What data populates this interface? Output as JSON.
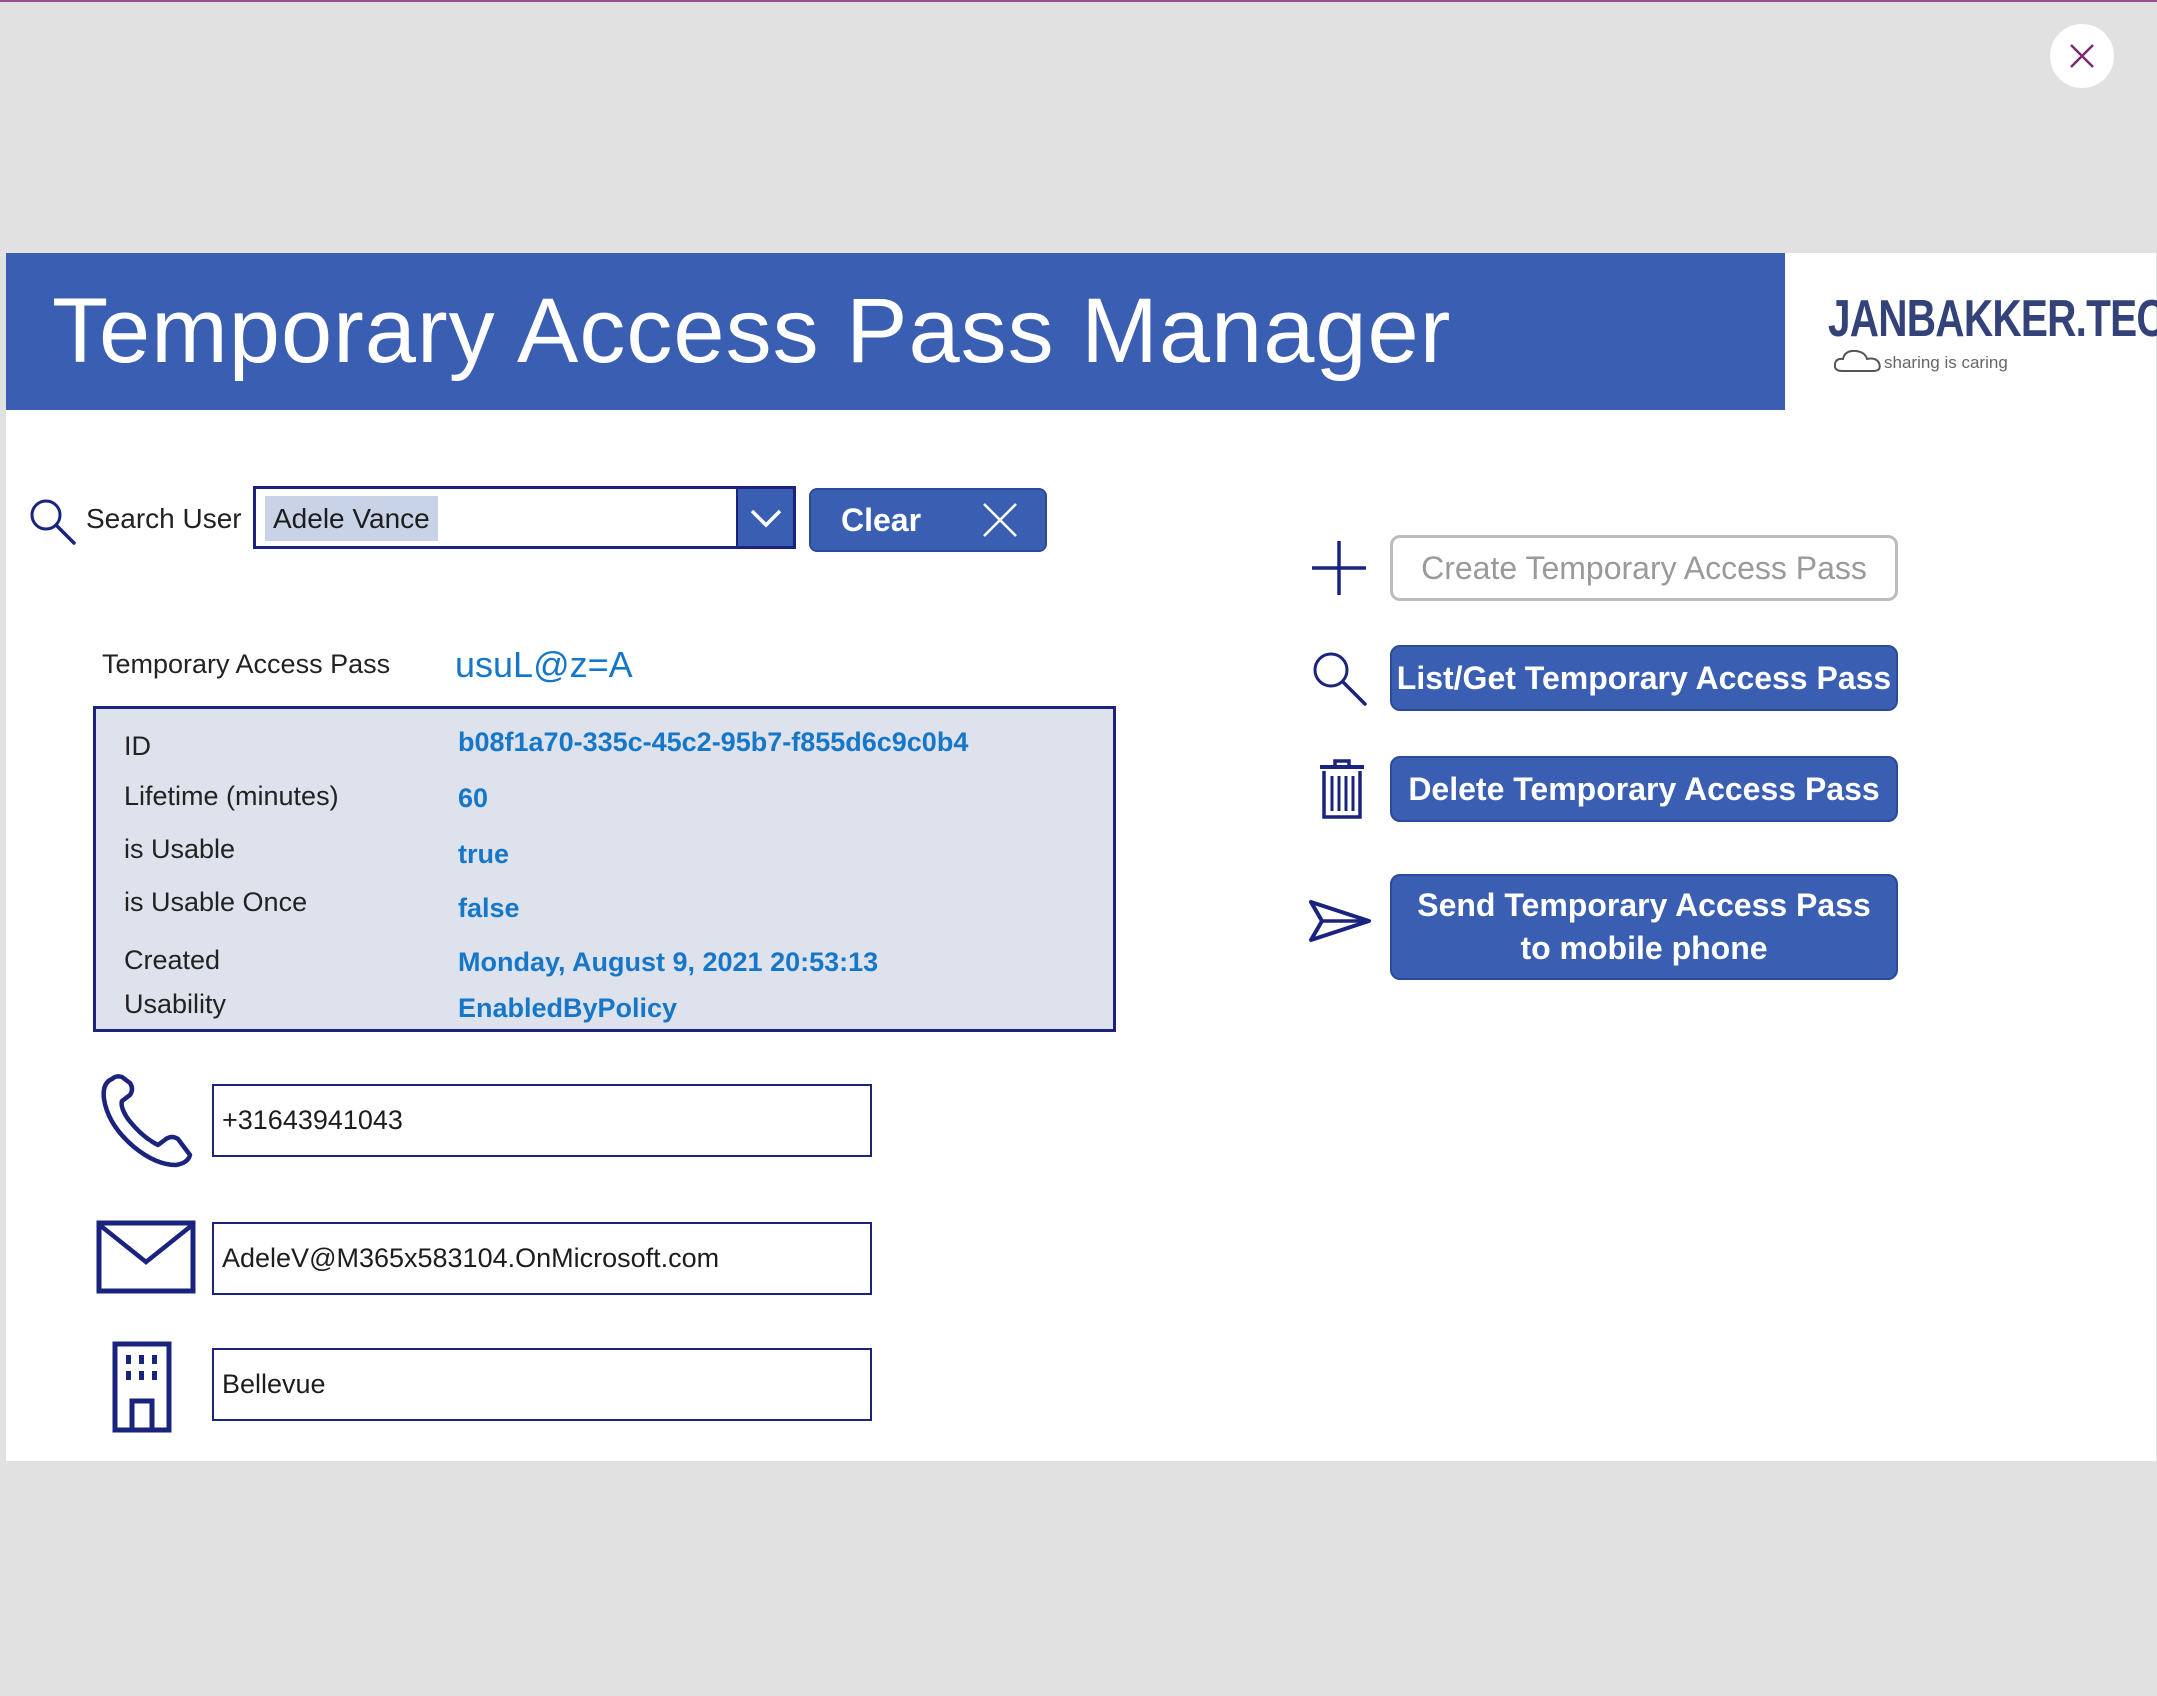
{
  "app": {
    "title": "Temporary Access Pass Manager",
    "logo_main": "JANBAKKER.TECH",
    "logo_tagline": "sharing is caring"
  },
  "search": {
    "label": "Search User",
    "selected_value": "Adele Vance",
    "clear_label": "Clear"
  },
  "tap": {
    "label": "Temporary Access Pass",
    "value": "usuL@z=A"
  },
  "details": [
    {
      "label": "ID",
      "value": "b08f1a70-335c-45c2-95b7-f855d6c9c0b4"
    },
    {
      "label": "Lifetime (minutes)",
      "value": "60"
    },
    {
      "label": "is Usable",
      "value": "true"
    },
    {
      "label": "is Usable Once",
      "value": "false"
    },
    {
      "label": "Created",
      "value": "Monday, August 9, 2021 20:53:13"
    },
    {
      "label": "Usability",
      "value": "EnabledByPolicy"
    }
  ],
  "contact": {
    "phone": "+31643941043",
    "email": "AdeleV@M365x583104.OnMicrosoft.com",
    "office": "Bellevue"
  },
  "actions": {
    "create": "Create Temporary Access Pass",
    "list": "List/Get Temporary Access Pass",
    "delete": "Delete Temporary Access Pass",
    "send": "Send Temporary Access Pass to mobile phone"
  },
  "colors": {
    "brand_blue": "#3a5fb2",
    "dark_navy": "#1a237e",
    "value_blue": "#1677c8",
    "panel_bg": "#dde2ec"
  },
  "icons": [
    "close-icon",
    "search-icon",
    "chevron-down-icon",
    "clear-x-icon",
    "phone-icon",
    "mail-icon",
    "building-icon",
    "plus-icon",
    "trash-icon",
    "send-icon",
    "cloud-icon"
  ]
}
